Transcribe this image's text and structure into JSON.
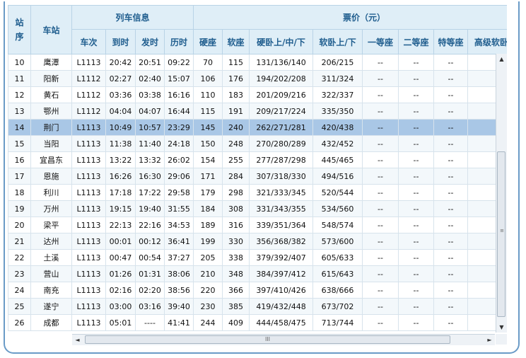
{
  "headers": {
    "station_index": "站序",
    "station_name": "车站",
    "train_info_group": "列车信息",
    "price_group": "票价（元）",
    "columns": [
      "车次",
      "到时",
      "发时",
      "历时",
      "硬座",
      "软座",
      "硬卧上/中/下",
      "软卧上/下",
      "一等座",
      "二等座",
      "特等座",
      "高级软卧上/下"
    ]
  },
  "rows": [
    {
      "idx": "10",
      "station": "鹰潭",
      "train": "L1113",
      "arrive": "20:42",
      "depart": "20:51",
      "duration": "09:22",
      "hard_seat": "70",
      "soft_seat": "115",
      "hard_sleeper": "131/136/140",
      "soft_sleeper": "206/215",
      "first": "--",
      "second": "--",
      "special": "--",
      "deluxe": ""
    },
    {
      "idx": "11",
      "station": "阳新",
      "train": "L1112",
      "arrive": "02:27",
      "depart": "02:40",
      "duration": "15:07",
      "hard_seat": "106",
      "soft_seat": "176",
      "hard_sleeper": "194/202/208",
      "soft_sleeper": "311/324",
      "first": "--",
      "second": "--",
      "special": "--",
      "deluxe": ""
    },
    {
      "idx": "12",
      "station": "黄石",
      "train": "L1112",
      "arrive": "03:36",
      "depart": "03:38",
      "duration": "16:16",
      "hard_seat": "110",
      "soft_seat": "183",
      "hard_sleeper": "201/209/216",
      "soft_sleeper": "322/337",
      "first": "--",
      "second": "--",
      "special": "--",
      "deluxe": ""
    },
    {
      "idx": "13",
      "station": "鄂州",
      "train": "L1112",
      "arrive": "04:04",
      "depart": "04:07",
      "duration": "16:44",
      "hard_seat": "115",
      "soft_seat": "191",
      "hard_sleeper": "209/217/224",
      "soft_sleeper": "335/350",
      "first": "--",
      "second": "--",
      "special": "--",
      "deluxe": ""
    },
    {
      "idx": "14",
      "station": "荆门",
      "train": "L1113",
      "arrive": "10:49",
      "depart": "10:57",
      "duration": "23:29",
      "hard_seat": "145",
      "soft_seat": "240",
      "hard_sleeper": "262/271/281",
      "soft_sleeper": "420/438",
      "first": "--",
      "second": "--",
      "special": "--",
      "deluxe": ""
    },
    {
      "idx": "15",
      "station": "当阳",
      "train": "L1113",
      "arrive": "11:38",
      "depart": "11:40",
      "duration": "24:18",
      "hard_seat": "150",
      "soft_seat": "248",
      "hard_sleeper": "270/280/289",
      "soft_sleeper": "432/452",
      "first": "--",
      "second": "--",
      "special": "--",
      "deluxe": ""
    },
    {
      "idx": "16",
      "station": "宜昌东",
      "train": "L1113",
      "arrive": "13:22",
      "depart": "13:32",
      "duration": "26:02",
      "hard_seat": "154",
      "soft_seat": "255",
      "hard_sleeper": "277/287/298",
      "soft_sleeper": "445/465",
      "first": "--",
      "second": "--",
      "special": "--",
      "deluxe": ""
    },
    {
      "idx": "17",
      "station": "恩施",
      "train": "L1113",
      "arrive": "16:26",
      "depart": "16:30",
      "duration": "29:06",
      "hard_seat": "171",
      "soft_seat": "284",
      "hard_sleeper": "307/318/330",
      "soft_sleeper": "494/516",
      "first": "--",
      "second": "--",
      "special": "--",
      "deluxe": ""
    },
    {
      "idx": "18",
      "station": "利川",
      "train": "L1113",
      "arrive": "17:18",
      "depart": "17:22",
      "duration": "29:58",
      "hard_seat": "179",
      "soft_seat": "298",
      "hard_sleeper": "321/333/345",
      "soft_sleeper": "520/544",
      "first": "--",
      "second": "--",
      "special": "--",
      "deluxe": ""
    },
    {
      "idx": "19",
      "station": "万州",
      "train": "L1113",
      "arrive": "19:15",
      "depart": "19:40",
      "duration": "31:55",
      "hard_seat": "184",
      "soft_seat": "308",
      "hard_sleeper": "331/343/355",
      "soft_sleeper": "534/560",
      "first": "--",
      "second": "--",
      "special": "--",
      "deluxe": ""
    },
    {
      "idx": "20",
      "station": "梁平",
      "train": "L1113",
      "arrive": "22:13",
      "depart": "22:16",
      "duration": "34:53",
      "hard_seat": "189",
      "soft_seat": "316",
      "hard_sleeper": "339/351/364",
      "soft_sleeper": "548/574",
      "first": "--",
      "second": "--",
      "special": "--",
      "deluxe": ""
    },
    {
      "idx": "21",
      "station": "达州",
      "train": "L1113",
      "arrive": "00:01",
      "depart": "00:12",
      "duration": "36:41",
      "hard_seat": "199",
      "soft_seat": "330",
      "hard_sleeper": "356/368/382",
      "soft_sleeper": "573/600",
      "first": "--",
      "second": "--",
      "special": "--",
      "deluxe": ""
    },
    {
      "idx": "22",
      "station": "土溪",
      "train": "L1113",
      "arrive": "00:47",
      "depart": "00:54",
      "duration": "37:27",
      "hard_seat": "205",
      "soft_seat": "338",
      "hard_sleeper": "379/392/407",
      "soft_sleeper": "605/633",
      "first": "--",
      "second": "--",
      "special": "--",
      "deluxe": ""
    },
    {
      "idx": "23",
      "station": "营山",
      "train": "L1113",
      "arrive": "01:26",
      "depart": "01:31",
      "duration": "38:06",
      "hard_seat": "210",
      "soft_seat": "348",
      "hard_sleeper": "384/397/412",
      "soft_sleeper": "615/643",
      "first": "--",
      "second": "--",
      "special": "--",
      "deluxe": ""
    },
    {
      "idx": "24",
      "station": "南充",
      "train": "L1113",
      "arrive": "02:16",
      "depart": "02:20",
      "duration": "38:56",
      "hard_seat": "220",
      "soft_seat": "366",
      "hard_sleeper": "397/410/426",
      "soft_sleeper": "638/666",
      "first": "--",
      "second": "--",
      "special": "--",
      "deluxe": ""
    },
    {
      "idx": "25",
      "station": "遂宁",
      "train": "L1113",
      "arrive": "03:00",
      "depart": "03:16",
      "duration": "39:40",
      "hard_seat": "230",
      "soft_seat": "385",
      "hard_sleeper": "419/432/448",
      "soft_sleeper": "673/702",
      "first": "--",
      "second": "--",
      "special": "--",
      "deluxe": ""
    },
    {
      "idx": "26",
      "station": "成都",
      "train": "L1113",
      "arrive": "05:01",
      "depart": "----",
      "duration": "41:41",
      "hard_seat": "244",
      "soft_seat": "409",
      "hard_sleeper": "444/458/475",
      "soft_sleeper": "713/744",
      "first": "--",
      "second": "--",
      "special": "--",
      "deluxe": ""
    }
  ],
  "selected_row": "14",
  "scrollbar": {
    "up_arrow": "▲",
    "down_arrow": "▼",
    "left_arrow": "◄",
    "right_arrow": "►",
    "v_grip": "≡",
    "h_grip": "III",
    "vertical_position": 0.45,
    "horizontal_position": 0.0
  },
  "colors": {
    "header_bg": "#dfeef7",
    "header_text": "#1f5d8e",
    "selected_row": "#a9c7e6",
    "frame": "#6a9bc7"
  }
}
